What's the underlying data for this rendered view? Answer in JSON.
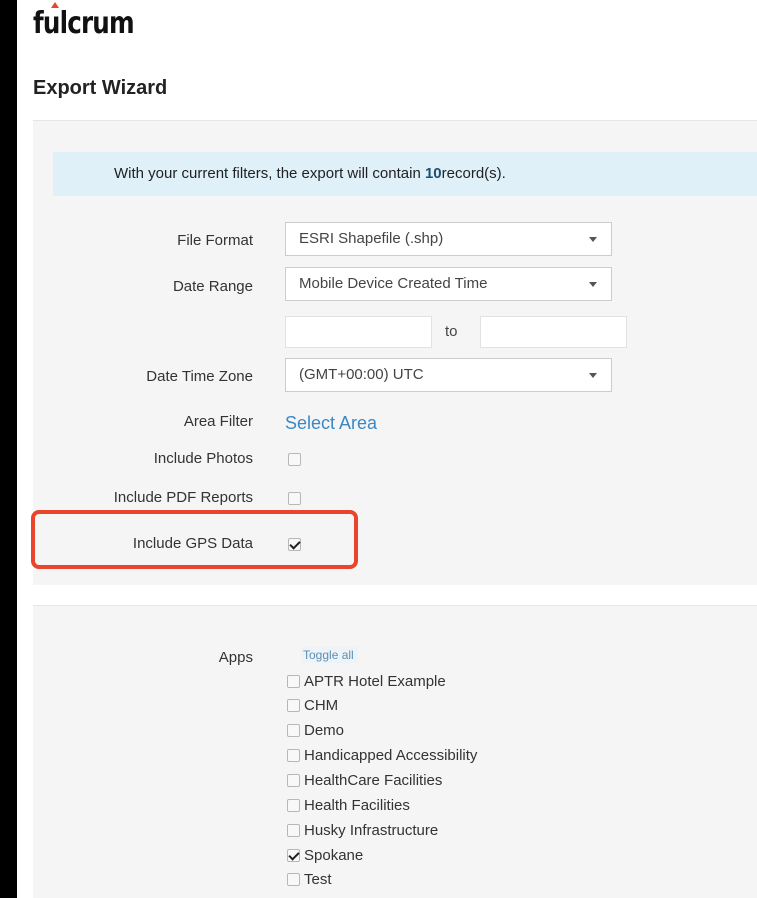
{
  "brand": {
    "logo_text": "fulcrum"
  },
  "page_title": "Export Wizard",
  "notice": {
    "prefix": "With your current filters, the export will contain",
    "count": "10",
    "suffix": "record(s)."
  },
  "form": {
    "file_format": {
      "label": "File Format",
      "value": "ESRI Shapefile (.shp)"
    },
    "date_range": {
      "label": "Date Range",
      "value": "Mobile Device Created Time",
      "from_value": "",
      "to_label": "to",
      "to_value": ""
    },
    "time_zone": {
      "label": "Date Time Zone",
      "value": "(GMT+00:00) UTC"
    },
    "area_filter": {
      "label": "Area Filter",
      "link": "Select Area"
    },
    "include_photos": {
      "label": "Include Photos",
      "checked": false
    },
    "include_pdf": {
      "label": "Include PDF Reports",
      "checked": false
    },
    "include_gps": {
      "label": "Include GPS Data",
      "checked": true
    }
  },
  "apps": {
    "label": "Apps",
    "toggle_all": "Toggle all",
    "items": [
      {
        "name": "APTR Hotel Example",
        "checked": false
      },
      {
        "name": "CHM",
        "checked": false
      },
      {
        "name": "Demo",
        "checked": false
      },
      {
        "name": "Handicapped Accessibility",
        "checked": false
      },
      {
        "name": "HealthCare Facilities",
        "checked": false
      },
      {
        "name": "Health Facilities",
        "checked": false
      },
      {
        "name": "Husky Infrastructure",
        "checked": false
      },
      {
        "name": "Spokane",
        "checked": true
      },
      {
        "name": "Test",
        "checked": false
      }
    ]
  },
  "colors": {
    "highlight": "#e8452c",
    "link": "#3a88c4",
    "notice_bg": "#dff0f8"
  }
}
